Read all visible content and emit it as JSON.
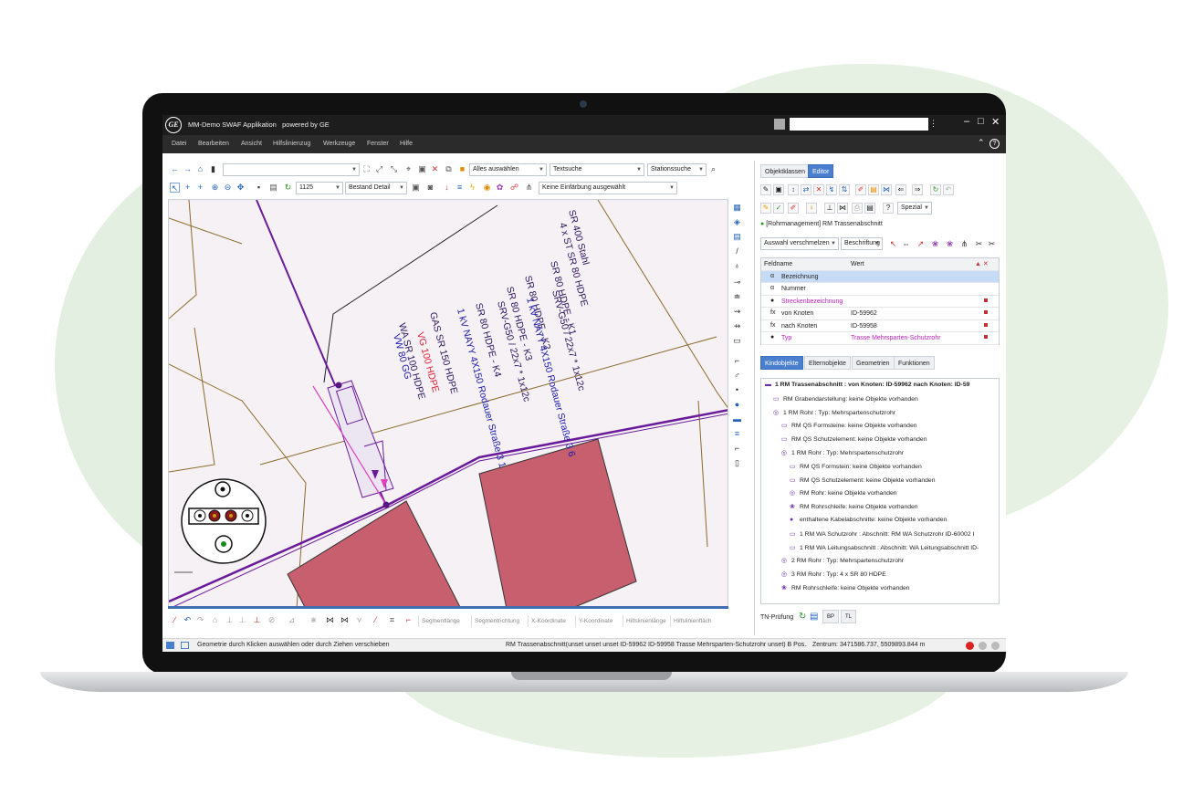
{
  "app": {
    "title": "MM-Demo SWAF Applikation",
    "powered": "powered by GE",
    "logo": "GE"
  },
  "menu": [
    "Datei",
    "Bearbeiten",
    "Ansicht",
    "Hilfslinienzug",
    "Werkzeuge",
    "Fenster",
    "Hilfe"
  ],
  "toolbar": {
    "select_all": "Alles auswählen",
    "text_search": "Textsuche",
    "station_search": "Stationssuche",
    "scale": "1125",
    "detail": "Bestand Detail",
    "coloring": "Keine Einfärbung ausgewählt"
  },
  "map": {
    "labels_dark": [
      "SR 400 Stahl",
      "4 x ST SR 80 HDPE",
      "SR 80 HDPE - K1",
      "SRV-G50 / 22x7 * 1x12c",
      "SR 80 HDPE - K2",
      "SR 80 HDPE - K3",
      "SRV-G50 / 22x7 * 1x12c",
      "SR 80 HDPE - K4",
      "GAS SR 150 HDPE",
      "WA SR 100 HDPE"
    ],
    "labels_blue": [
      "1 kV NAYY 4X150 Rodauer Straße 3 6",
      "1 kV NAYY 4X150 Rodauer Straße 3 1",
      "VW 80 GG"
    ],
    "labels_red": [
      "VG 100 HDPE"
    ]
  },
  "bottom_tabs": [
    "Segmentlänge",
    "Segmentrichtung",
    "X-Koordinate",
    "Y-Koordinate",
    "Hilfslinienlänge",
    "Hilfslinienfläch"
  ],
  "status": {
    "hint": "Geometrie durch Klicken auswählen oder durch Ziehen verschieben",
    "selection": "RM Trassenabschnitt(unset unset unset ID-59962 ID-59958 Trasse Mehrsparten-Schutzrohr unset) B Pos...",
    "center": "Zentrum: 3471586.737, 5509893.844 m"
  },
  "panel": {
    "tabs": [
      "Objektklassen",
      "Editor"
    ],
    "special": "Spezial",
    "object_header": "[Rohrmanagement] RM Trassenabschnitt",
    "merge": "Auswahl verschmelzen",
    "label": "Beschriftung",
    "grid_headers": [
      "Feldname",
      "Wert"
    ],
    "rows": [
      {
        "name": "Bezeichnung",
        "value": "",
        "icon": "α"
      },
      {
        "name": "Nummer",
        "value": "",
        "icon": "α"
      },
      {
        "name": "Streckenbezeichnung",
        "value": "",
        "icon": "●"
      },
      {
        "name": "von Knoten",
        "value": "ID-59962",
        "icon": "fx"
      },
      {
        "name": "nach Knoten",
        "value": "ID-59958",
        "icon": "fx"
      },
      {
        "name": "Typ",
        "value": "Trasse Mehrsparten-Schutzrohr",
        "icon": "●"
      }
    ],
    "lower_tabs": [
      "Kindobjekte",
      "Elternobjekte",
      "Geometrien",
      "Funktionen"
    ],
    "tree": [
      {
        "text": "1 RM Trassenabschnitt :   von Knoten: ID-59962 nach Knoten: ID-59",
        "indent": 0,
        "icon": "▬"
      },
      {
        "text": "RM Grabendarstellung: keine Objekte vorhanden",
        "indent": 1,
        "icon": "▭"
      },
      {
        "text": "1 RM Rohr :   Typ: Mehrspartenschutzrohr",
        "indent": 1,
        "icon": "◎"
      },
      {
        "text": "RM QS Formsteine: keine Objekte vorhanden",
        "indent": 2,
        "icon": "▭"
      },
      {
        "text": "RM QS Schutzelement: keine Objekte vorhanden",
        "indent": 2,
        "icon": "▭"
      },
      {
        "text": "1 RM Rohr :   Typ: Mehrspartenschutzrohr",
        "indent": 2,
        "icon": "◎"
      },
      {
        "text": "RM QS Formstein: keine Objekte vorhanden",
        "indent": 3,
        "icon": "▭"
      },
      {
        "text": "RM QS Schutzelement: keine Objekte vorhanden",
        "indent": 3,
        "icon": "▭"
      },
      {
        "text": "RM Rohr: keine Objekte vorhanden",
        "indent": 3,
        "icon": "◎"
      },
      {
        "text": "RM Rohrschleife: keine Objekte vorhanden",
        "indent": 3,
        "icon": "❀"
      },
      {
        "text": "enthaltene Kabelabschnitte: keine Objekte vorhanden",
        "indent": 3,
        "icon": "●"
      },
      {
        "text": "1 RM WA Schutzrohr :   Abschnitt: RM WA Schutzrohr ID-60002 I",
        "indent": 3,
        "icon": "▭"
      },
      {
        "text": "1 RM WA Leitungsabschnitt :   Abschnitt: WA Leitungsabschnitt ID-",
        "indent": 3,
        "icon": "▭"
      },
      {
        "text": "2 RM Rohr :   Typ: Mehrspartenschutzrohr",
        "indent": 2,
        "icon": "◎"
      },
      {
        "text": "3 RM Rohr :   Typ: 4 x SR 80 HDPE",
        "indent": 2,
        "icon": "◎"
      },
      {
        "text": "RM Rohrschleife: keine Objekte vorhanden",
        "indent": 2,
        "icon": "❀"
      }
    ],
    "tn_check": "TN-Prüfung",
    "bp": "BP",
    "tl": "TL"
  }
}
